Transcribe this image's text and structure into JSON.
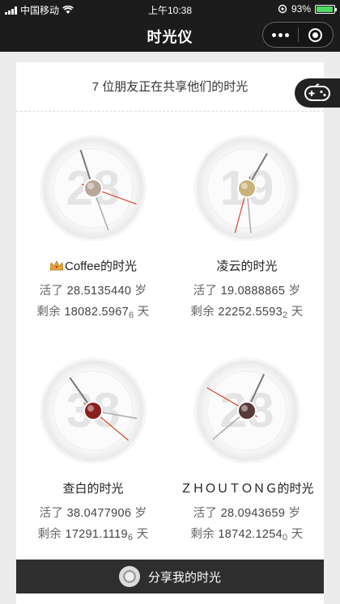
{
  "status_bar": {
    "carrier": "中国移动",
    "time": "上午10:38",
    "battery_percent": "93%",
    "battery_level": 0.93,
    "icons": [
      "signal-icon",
      "wifi-icon",
      "location-lock-icon",
      "battery-icon"
    ]
  },
  "nav": {
    "title": "时光仪",
    "icons": [
      "more-dots-icon",
      "close-target-icon"
    ]
  },
  "header": {
    "text": "7 位朋友正在共享他们的时光"
  },
  "game_button": {
    "icon": "gamepad-icon"
  },
  "friends": [
    {
      "badge_icon": "crown-icon",
      "name_suffix": "Coffee的时光",
      "clock_number": "28",
      "age_label": "活了",
      "age_value": "28.5135440",
      "age_unit": "岁",
      "remain_label": "剩余",
      "remain_value": "18082.5967",
      "remain_sub": "6",
      "remain_unit": "天",
      "avatar_color": "#b9a89a"
    },
    {
      "badge_icon": "",
      "name_suffix": "凌云的时光",
      "clock_number": "19",
      "age_label": "活了",
      "age_value": "19.0888865",
      "age_unit": "岁",
      "remain_label": "剩余",
      "remain_value": "22252.5593",
      "remain_sub": "2",
      "remain_unit": "天",
      "avatar_color": "#c8b27a"
    },
    {
      "badge_icon": "",
      "name_suffix": "查白的时光",
      "clock_number": "38",
      "age_label": "活了",
      "age_value": "38.0477906",
      "age_unit": "岁",
      "remain_label": "剩余",
      "remain_value": "17291.1119",
      "remain_sub": "6",
      "remain_unit": "天",
      "avatar_color": "#8b1f1f"
    },
    {
      "badge_icon": "",
      "name_suffix": "ＺＨＯＵＴＯＮＧ的时光",
      "clock_number": "28",
      "age_label": "活了",
      "age_value": "28.0943659",
      "age_unit": "岁",
      "remain_label": "剩余",
      "remain_value": "18742.1254",
      "remain_sub": "0",
      "remain_unit": "天",
      "avatar_color": "#5a3a3a"
    }
  ],
  "share": {
    "label": "分享我的时光",
    "icon": "share-avatar-icon"
  }
}
